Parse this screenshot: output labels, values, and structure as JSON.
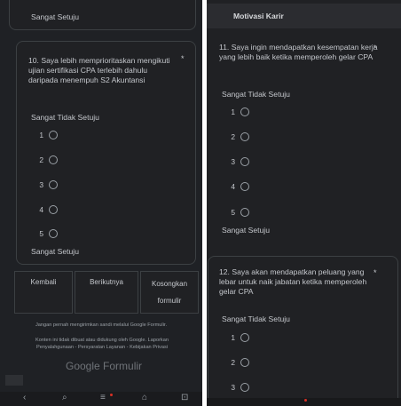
{
  "left": {
    "prev_label": "Sangat Setuju",
    "q10": {
      "title": "10. Saya lebih memprioritaskan mengikuti ujian sertifikasi CPA terlebih dahulu daripada menempuh S2 Akuntansi",
      "required": "*",
      "low_label": "Sangat Tidak Setuju",
      "high_label": "Sangat Setuju",
      "options": [
        "1",
        "2",
        "3",
        "4",
        "5"
      ]
    },
    "buttons": {
      "back": "Kembali",
      "next": "Berikutnya",
      "clear": "Kosongkan formulir"
    },
    "footer": {
      "password_warning": "Jangan pernah mengirimkan sandi melalui Google Formulir.",
      "disclaimer": "Konten ini tidak dibuat atau didukung oleh Google. Laporkan Penyalahgunaan - Persyaratan Layanan - Kebijakan Privasi",
      "brand": "Google Formulir"
    },
    "nav_icons": [
      "‹",
      "⌕",
      "≡",
      "⌂",
      "⊡"
    ]
  },
  "right": {
    "section_title": "Motivasi Karir",
    "q11": {
      "title": "11. Saya ingin mendapatkan kesempatan kerja yang lebih baik ketika memperoleh gelar CPA",
      "required": "*",
      "low_label": "Sangat Tidak Setuju",
      "high_label": "Sangat Setuju",
      "options": [
        "1",
        "2",
        "3",
        "4",
        "5"
      ]
    },
    "q12": {
      "title": "12. Saya akan mendapatkan peluang yang lebar untuk naik jabatan ketika memperoleh gelar CPA",
      "required": "*",
      "low_label": "Sangat Tidak Setuju",
      "options": [
        "1",
        "2",
        "3"
      ]
    }
  }
}
